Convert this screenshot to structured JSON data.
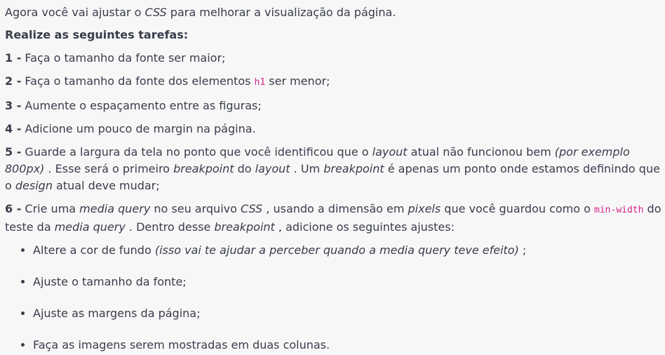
{
  "intro": {
    "part1": "Agora você vai ajustar o ",
    "css": "CSS",
    "part2": " para melhorar a visualização da página."
  },
  "heading": "Realize as seguintes tarefas:",
  "task1": {
    "num": "1 -",
    "text": " Faça o tamanho da fonte ser maior;"
  },
  "task2": {
    "num": "2 -",
    "text1": " Faça o tamanho da fonte dos elementos ",
    "code": "h1",
    "text2": " ser menor;"
  },
  "task3": {
    "num": "3 -",
    "text": " Aumente o espaçamento entre as figuras;"
  },
  "task4": {
    "num": "4 -",
    "text": " Adicione um pouco de margin na página."
  },
  "task5": {
    "num": "5 -",
    "t1": " Guarde a largura da tela no ponto que você identificou que o ",
    "layout1": "layout",
    "t2": " atual não funcionou bem ",
    "example": "(por exemplo 800px)",
    "t3": " . Esse será o primeiro ",
    "breakpoint1": "breakpoint",
    "t4": " do ",
    "layout2": "layout",
    "t5": " . Um ",
    "breakpoint2": "breakpoint",
    "t6": " é apenas um ponto onde estamos definindo que o ",
    "design": "design",
    "t7": " atual deve mudar;"
  },
  "task6": {
    "num": "6 -",
    "t1": " Crie uma ",
    "mq1": "media query",
    "t2": " no seu arquivo ",
    "css": "CSS",
    "t3": " , usando a dimensão em ",
    "pixels": "pixels",
    "t4": " que você guardou como o ",
    "code": "min-width",
    "t5": " do teste da ",
    "mq2": "media query",
    "t6": " . Dentro desse ",
    "breakpoint": "breakpoint",
    "t7": " , adicione os seguintes ajustes:"
  },
  "bullets": {
    "b1_text": "Altere a cor de fundo ",
    "b1_em": "(isso vai te ajudar a perceber quando a media query teve efeito)",
    "b1_end": " ;",
    "b2": "Ajuste o tamanho da fonte;",
    "b3": "Ajuste as margens da página;",
    "b4": "Faça as imagens serem mostradas em duas colunas."
  }
}
